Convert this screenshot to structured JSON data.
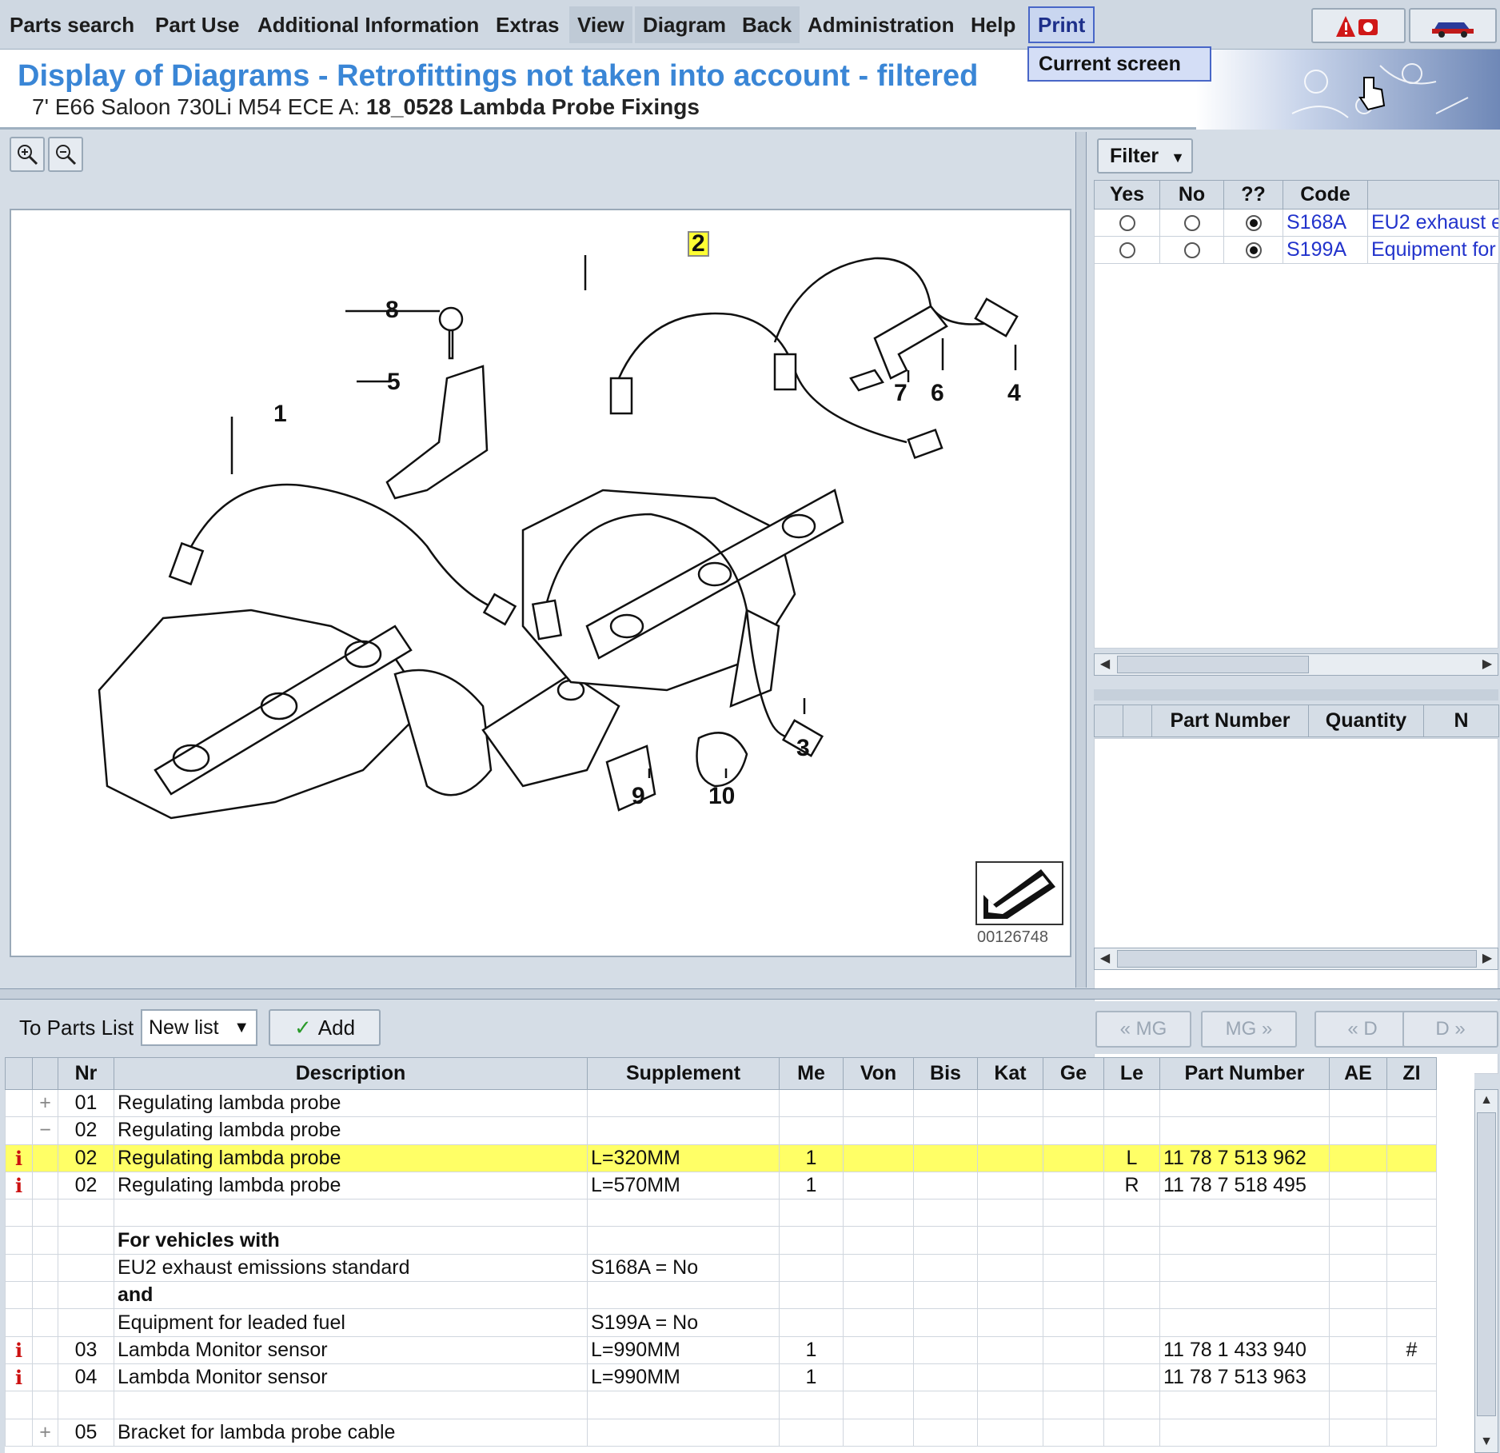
{
  "menu": {
    "items": [
      "Parts search",
      "Part Use",
      "Additional Information",
      "Extras",
      "View",
      "Diagram",
      "Back",
      "Administration",
      "Help",
      "Print"
    ],
    "dropdown_item": "Current screen"
  },
  "header": {
    "title": "Display of Diagrams - Retrofittings not taken into account - filtered",
    "vehicle": "7' E66 Saloon 730Li M54 ECE  A:",
    "diagram_ref": "18_0528 Lambda Probe Fixings"
  },
  "diagram": {
    "callouts": [
      "1",
      "2",
      "3",
      "4",
      "5",
      "6",
      "7",
      "8",
      "9",
      "10"
    ],
    "highlighted_callout": "2",
    "image_id": "00126748"
  },
  "filter": {
    "button_label": "Filter",
    "columns": [
      "Yes",
      "No",
      "??",
      "Code",
      ""
    ],
    "rows": [
      {
        "yes": false,
        "no": false,
        "unknown": true,
        "code": "S168A",
        "desc": "EU2 exhaust e"
      },
      {
        "yes": false,
        "no": false,
        "unknown": true,
        "code": "S199A",
        "desc": "Equipment for"
      }
    ]
  },
  "part_panel": {
    "columns": [
      "",
      "",
      "Part Number",
      "Quantity",
      "N"
    ]
  },
  "toolbar": {
    "to_parts_list": "To Parts List",
    "list_select": "New list",
    "add_label": "Add",
    "nav": [
      "« MG",
      "MG »",
      "« D",
      "D »"
    ]
  },
  "grid": {
    "columns": [
      "",
      "",
      "Nr",
      "Description",
      "Supplement",
      "Me",
      "Von",
      "Bis",
      "Kat",
      "Ge",
      "Le",
      "Part Number",
      "AE",
      "ZI"
    ],
    "rows": [
      {
        "info": "",
        "tree": "+",
        "nr": "01",
        "desc": "Regulating lambda probe",
        "supp": "",
        "me": "",
        "le": "",
        "pn": "",
        "zi": "",
        "bold": false,
        "sel": false
      },
      {
        "info": "",
        "tree": "−",
        "nr": "02",
        "desc": "Regulating lambda probe",
        "supp": "",
        "me": "",
        "le": "",
        "pn": "",
        "zi": "",
        "bold": false,
        "sel": false
      },
      {
        "info": "i",
        "tree": "",
        "nr": "02",
        "desc": "Regulating lambda probe",
        "supp": "L=320MM",
        "me": "1",
        "le": "L",
        "pn": "11 78 7 513 962",
        "zi": "",
        "bold": false,
        "sel": true
      },
      {
        "info": "i",
        "tree": "",
        "nr": "02",
        "desc": "Regulating lambda probe",
        "supp": "L=570MM",
        "me": "1",
        "le": "R",
        "pn": "11 78 7 518 495",
        "zi": "",
        "bold": false,
        "sel": false
      },
      {
        "info": "",
        "tree": "",
        "nr": "",
        "desc": "",
        "supp": "",
        "me": "",
        "le": "",
        "pn": "",
        "zi": "",
        "bold": false,
        "sel": false
      },
      {
        "info": "",
        "tree": "",
        "nr": "",
        "desc": "For vehicles with",
        "supp": "",
        "me": "",
        "le": "",
        "pn": "",
        "zi": "",
        "bold": true,
        "sel": false
      },
      {
        "info": "",
        "tree": "",
        "nr": "",
        "desc": "EU2 exhaust emissions standard",
        "supp": "S168A = No",
        "me": "",
        "le": "",
        "pn": "",
        "zi": "",
        "bold": false,
        "sel": false
      },
      {
        "info": "",
        "tree": "",
        "nr": "",
        "desc": "and",
        "supp": "",
        "me": "",
        "le": "",
        "pn": "",
        "zi": "",
        "bold": true,
        "sel": false
      },
      {
        "info": "",
        "tree": "",
        "nr": "",
        "desc": "Equipment for leaded fuel",
        "supp": "S199A = No",
        "me": "",
        "le": "",
        "pn": "",
        "zi": "",
        "bold": false,
        "sel": false
      },
      {
        "info": "i",
        "tree": "",
        "nr": "03",
        "desc": "Lambda Monitor sensor",
        "supp": "L=990MM",
        "me": "1",
        "le": "",
        "pn": "11 78 1 433 940",
        "zi": "#",
        "bold": false,
        "sel": false
      },
      {
        "info": "i",
        "tree": "",
        "nr": "04",
        "desc": "Lambda Monitor sensor",
        "supp": "L=990MM",
        "me": "1",
        "le": "",
        "pn": "11 78 7 513 963",
        "zi": "",
        "bold": false,
        "sel": false
      },
      {
        "info": "",
        "tree": "",
        "nr": "",
        "desc": "",
        "supp": "",
        "me": "",
        "le": "",
        "pn": "",
        "zi": "",
        "bold": false,
        "sel": false
      },
      {
        "info": "",
        "tree": "+",
        "nr": "05",
        "desc": "Bracket for lambda probe cable",
        "supp": "",
        "me": "",
        "le": "",
        "pn": "",
        "zi": "",
        "bold": false,
        "sel": false
      }
    ]
  },
  "colors": {
    "title_blue": "#3a86d6",
    "selection_yellow": "#ffff66",
    "code_link": "#2233cc",
    "info_red": "#cc1111"
  }
}
